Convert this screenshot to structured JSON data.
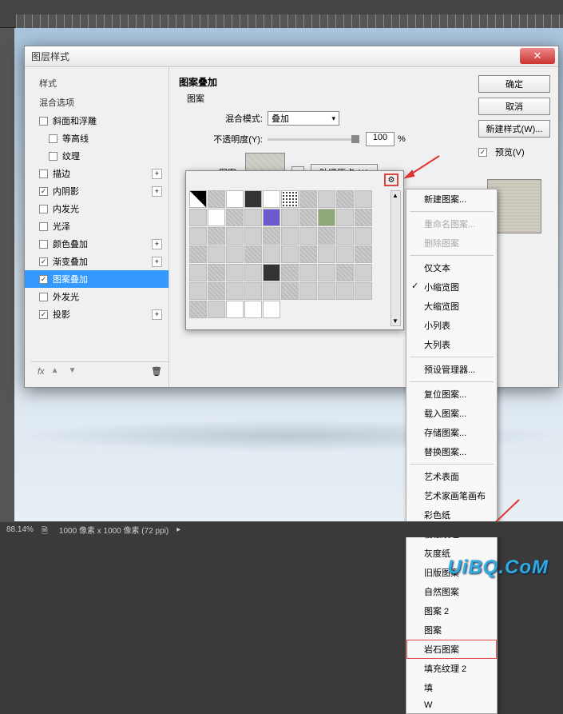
{
  "dialog": {
    "title": "图层样式",
    "close": "✕"
  },
  "styles": {
    "header": "样式",
    "blend_options": "混合选项",
    "items": [
      {
        "label": "斜面和浮雕",
        "checked": false,
        "expand": false
      },
      {
        "label": "等高线",
        "checked": false,
        "expand": false,
        "indent": true
      },
      {
        "label": "纹理",
        "checked": false,
        "expand": false,
        "indent": true
      },
      {
        "label": "描边",
        "checked": false,
        "expand": true
      },
      {
        "label": "内阴影",
        "checked": true,
        "expand": true
      },
      {
        "label": "内发光",
        "checked": false,
        "expand": false
      },
      {
        "label": "光泽",
        "checked": false,
        "expand": false
      },
      {
        "label": "颜色叠加",
        "checked": false,
        "expand": true
      },
      {
        "label": "渐变叠加",
        "checked": true,
        "expand": true
      },
      {
        "label": "图案叠加",
        "checked": true,
        "expand": false,
        "selected": true
      },
      {
        "label": "外发光",
        "checked": false,
        "expand": false
      },
      {
        "label": "投影",
        "checked": true,
        "expand": true
      }
    ],
    "fx": "fx"
  },
  "overlay": {
    "section": "图案叠加",
    "sub": "图案",
    "blend_mode_label": "混合模式:",
    "blend_mode_value": "叠加",
    "opacity_label": "不透明度(Y):",
    "opacity_value": "100",
    "opacity_unit": "%",
    "pattern_label": "图案:",
    "origin_btn": "贴紧原点 (A)"
  },
  "buttons": {
    "ok": "确定",
    "cancel": "取消",
    "new_style": "新建样式(W)...",
    "preview": "预览(V)"
  },
  "menu": {
    "new_pattern": "新建图案...",
    "rename": "重命名图案...",
    "delete": "删除图案",
    "text_only": "仅文本",
    "small_thumb": "小缩览图",
    "large_thumb": "大缩览图",
    "small_list": "小列表",
    "large_list": "大列表",
    "preset_mgr": "预设管理器...",
    "reset": "复位图案...",
    "load": "载入图案...",
    "save": "存储图案...",
    "replace": "替换图案...",
    "art_surface": "艺术表面",
    "art_canvas": "艺术家画笔画布",
    "color_paper": "彩色纸",
    "erosion": "侵蚀纹理",
    "gray_paper": "灰度纸",
    "old_pattern": "旧版图案",
    "nature": "自然图案",
    "pattern2": "图案 2",
    "pattern": "图案",
    "rock": "岩石图案",
    "fill2": "填充纹理 2",
    "fill": "填",
    "web": "W"
  },
  "status": {
    "zoom": "88.14%",
    "doc_info": "1000 像素 x 1000 像素 (72 ppi)"
  },
  "watermark": "UiBQ.CoM"
}
